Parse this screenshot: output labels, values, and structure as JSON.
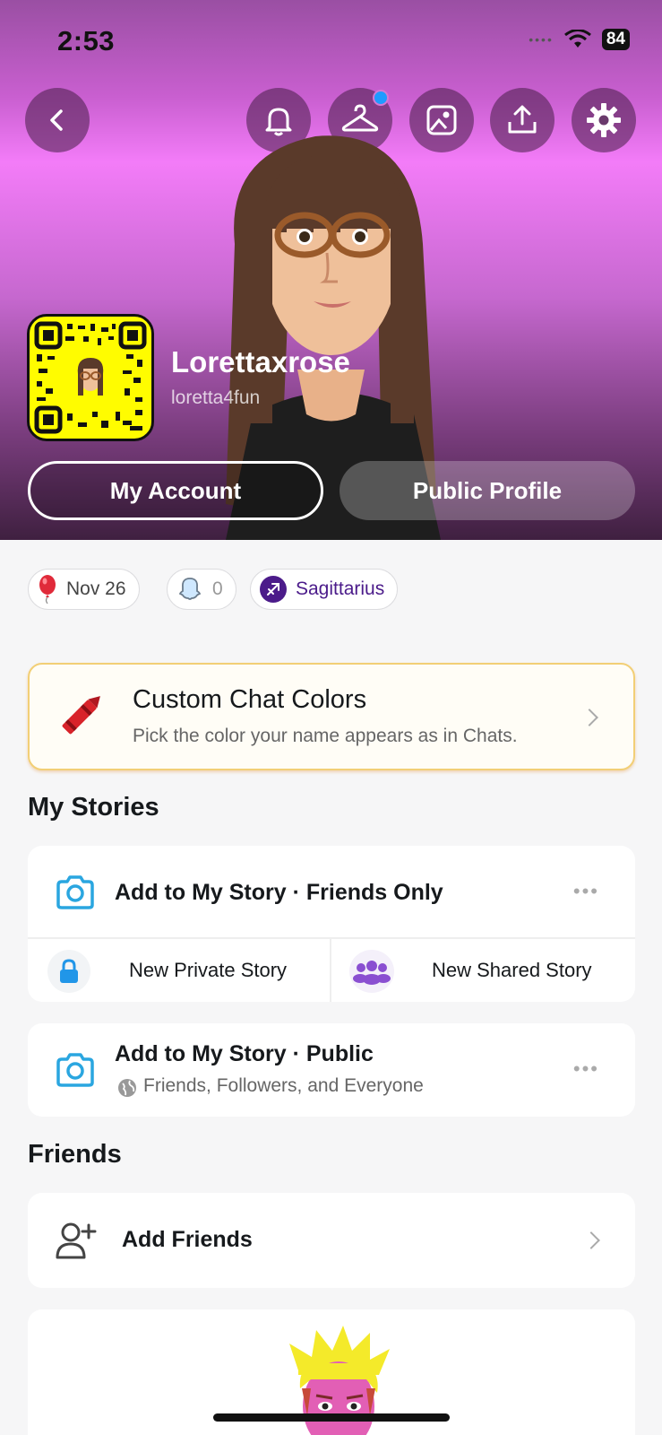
{
  "status": {
    "time": "2:53",
    "battery": "84"
  },
  "header_icons": [
    "back-icon",
    "bell-icon",
    "hanger-icon",
    "image-icon",
    "upload-icon",
    "gear-icon"
  ],
  "profile": {
    "display_name": "Lorettaxrose",
    "username": "loretta4fun"
  },
  "buttons": {
    "my_account": "My Account",
    "public_profile": "Public Profile"
  },
  "chips": {
    "birthday": "Nov 26",
    "snap_score": "0",
    "zodiac": "Sagittarius"
  },
  "promo": {
    "title": "Custom Chat Colors",
    "subtitle": "Pick the color your name appears as in Chats."
  },
  "stories": {
    "section_title": "My Stories",
    "friends_only": "Add to My Story · Friends Only",
    "new_private": "New Private Story",
    "new_shared": "New Shared Story",
    "public_title": "Add to My Story · Public",
    "public_sub": "Friends, Followers, and Everyone"
  },
  "friends": {
    "section_title": "Friends",
    "add_friends": "Add Friends"
  },
  "colors": {
    "accent_blue": "#1e9bff",
    "camera_blue": "#2aa6e0",
    "zodiac_purple": "#4b1b8a",
    "snap_yellow": "#fffc00"
  }
}
